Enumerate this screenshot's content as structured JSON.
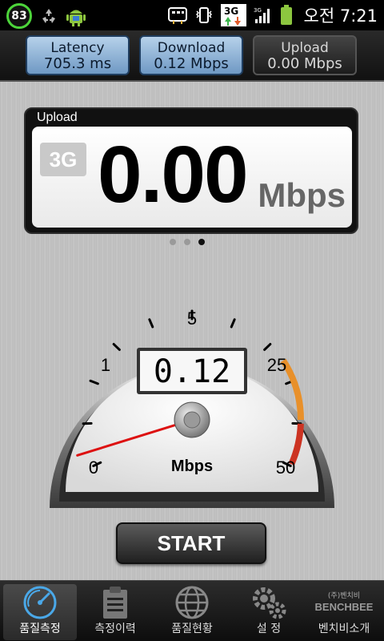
{
  "status_bar": {
    "battery_level": "83",
    "network": "3G",
    "ampm": "오전",
    "time": "7:21",
    "accent": "#4cd43a",
    "icons": [
      "recycle-icon",
      "android-icon",
      "sim-icon",
      "vibrate-icon",
      "3g-icon",
      "signal-icon",
      "battery-icon"
    ]
  },
  "top_tabs": [
    {
      "label": "Latency",
      "value": "705.3 ms",
      "active": true
    },
    {
      "label": "Download",
      "value": "0.12 Mbps",
      "active": true
    },
    {
      "label": "Upload",
      "value": "0.00 Mbps",
      "active": false
    }
  ],
  "panel": {
    "title": "Upload",
    "badge": "3G",
    "value": "0.00",
    "unit": "Mbps"
  },
  "page_dots": {
    "count": 3,
    "active_index": 2
  },
  "gauge": {
    "display_value": "0.12",
    "unit": "Mbps",
    "scale_labels": [
      "0",
      "1",
      "5",
      "25",
      "50"
    ],
    "needle_value": 0.12,
    "warning_color": "#e8902a",
    "danger_color": "#cc3322",
    "needle_color": "#dd1111"
  },
  "start_button": {
    "label": "START"
  },
  "bottom_nav": [
    {
      "label": "품질측정",
      "icon": "gauge-icon",
      "active": true
    },
    {
      "label": "측정이력",
      "icon": "clipboard-icon",
      "active": false
    },
    {
      "label": "품질현황",
      "icon": "globe-icon",
      "active": false
    },
    {
      "label": "설 정",
      "icon": "gears-icon",
      "active": false
    },
    {
      "label": "벤치비소개",
      "icon": "benchbee-logo-icon",
      "active": false
    }
  ],
  "benchbee_logo": {
    "small": "(주)벤치비",
    "brand": "BENCHBEE"
  }
}
